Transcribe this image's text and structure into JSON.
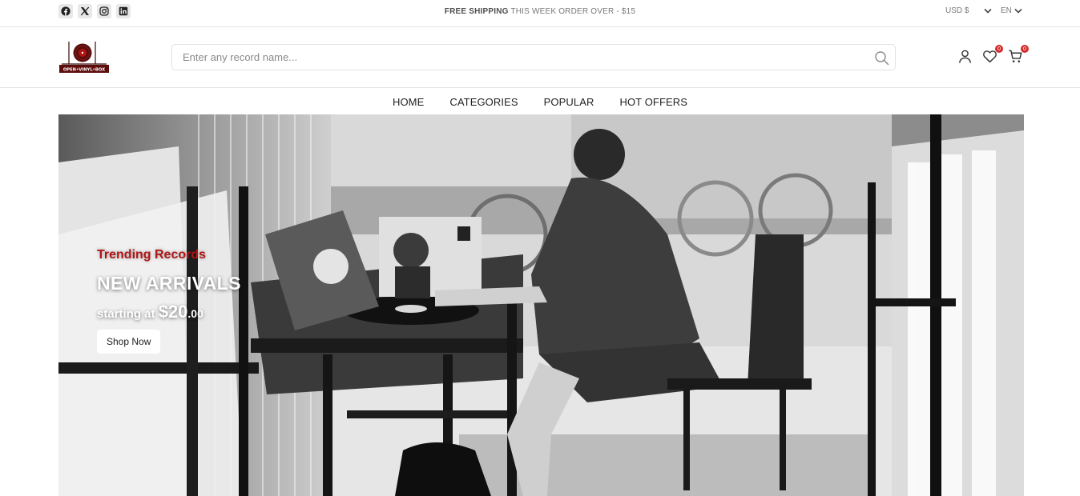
{
  "topbar": {
    "social_icons": [
      "facebook-icon",
      "x-icon",
      "instagram-icon",
      "linkedin-icon"
    ],
    "promo_bold": "FREE SHIPPING",
    "promo_rest": "THIS WEEK ORDER OVER - $15",
    "currency": "USD $",
    "language": "EN"
  },
  "header": {
    "logo_text": "OPEN•VINYL•BOX",
    "search_placeholder": "Enter any record name...",
    "wishlist_count": "0",
    "cart_count": "0"
  },
  "nav": {
    "items": [
      "HOME",
      "CATEGORIES",
      "POPULAR",
      "HOT OFFERS"
    ]
  },
  "hero": {
    "eyebrow": "Trending Records",
    "headline": "NEW ARRIVALS",
    "price_prefix": "starting at",
    "price_main": "$20",
    "price_cents": ".00",
    "cta": "Shop Now"
  },
  "colors": {
    "brand_red": "#b01515",
    "logo_dark": "#6a1212",
    "badge_red": "#d32a2a",
    "text_dark": "#212121",
    "border": "#e5e5e5"
  }
}
